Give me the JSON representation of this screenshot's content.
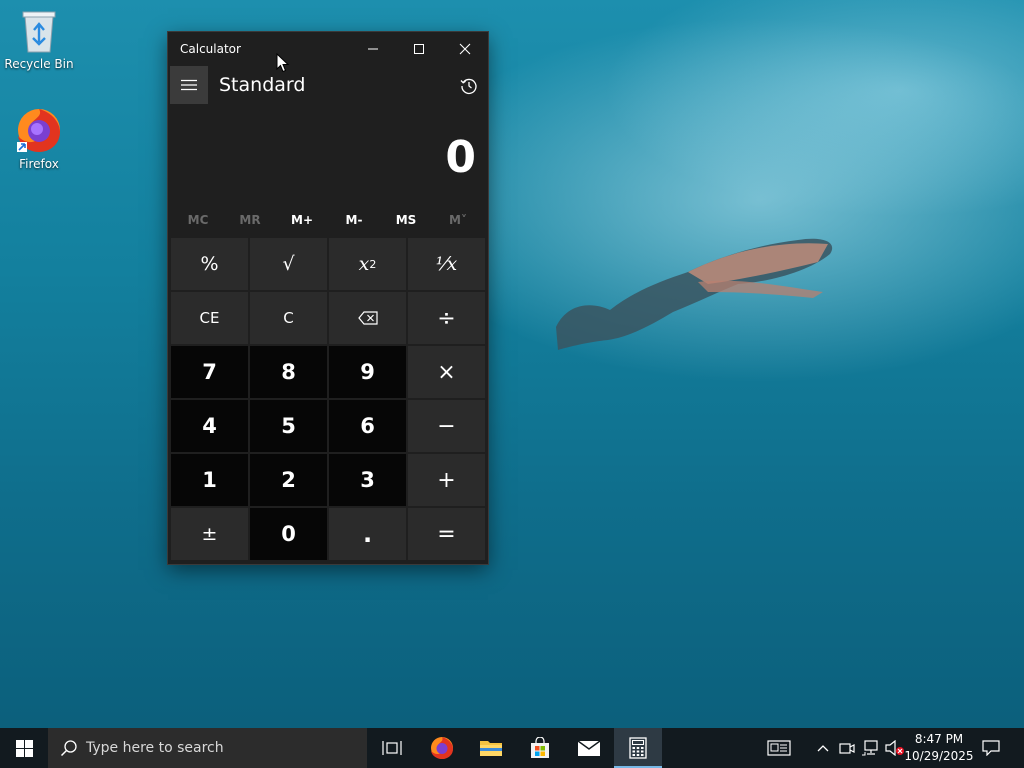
{
  "desktop": {
    "icons": [
      {
        "label": "Recycle Bin"
      },
      {
        "label": "Firefox"
      }
    ]
  },
  "calculator": {
    "window_title": "Calculator",
    "mode": "Standard",
    "display": "0",
    "memory_buttons": [
      "MC",
      "MR",
      "M+",
      "M-",
      "MS",
      "M˅"
    ],
    "keys": {
      "percent": "%",
      "sqrt": "√",
      "square_base": "x",
      "square_exp": "2",
      "reciprocal": "⅟x",
      "ce": "CE",
      "c": "C",
      "divide": "÷",
      "d7": "7",
      "d8": "8",
      "d9": "9",
      "multiply": "×",
      "d4": "4",
      "d5": "5",
      "d6": "6",
      "minus": "−",
      "d1": "1",
      "d2": "2",
      "d3": "3",
      "plus": "+",
      "negate": "±",
      "d0": "0",
      "decimal": ".",
      "equals": "="
    }
  },
  "taskbar": {
    "search_placeholder": "Type here to search",
    "clock_time": "8:47 PM",
    "clock_date": "10/29/2025"
  },
  "colors": {
    "accent": "#77b8e6",
    "calc_bg": "#1f1f1f",
    "key_op": "#2b2b2b",
    "key_num": "#060606"
  }
}
